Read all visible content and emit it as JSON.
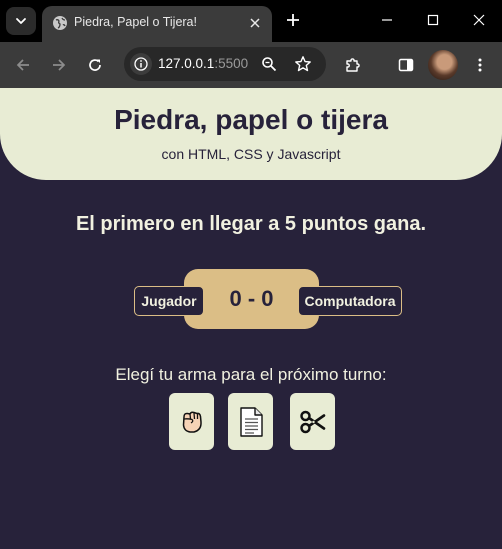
{
  "browser": {
    "tab_title": "Piedra, Papel o Tijera!",
    "url_host": "127.0.0.1",
    "url_port": ":5500"
  },
  "header": {
    "title": "Piedra, papel o tijera",
    "subtitle": "con HTML, CSS y Javascript"
  },
  "game": {
    "goal_text": "El primero en llegar a 5 puntos gana.",
    "player_label": "Jugador",
    "computer_label": "Computadora",
    "score": "0 - 0",
    "prompt": "Elegí tu arma para el próximo turno:",
    "weapons": [
      {
        "name": "piedra",
        "icon": "fist-icon"
      },
      {
        "name": "papel",
        "icon": "paper-icon"
      },
      {
        "name": "tijera",
        "icon": "scissors-icon"
      }
    ]
  },
  "colors": {
    "background": "#27223a",
    "header_bg": "#e8ecd4",
    "score_bg": "#dbbe86",
    "text_light": "#f1f1e0"
  }
}
